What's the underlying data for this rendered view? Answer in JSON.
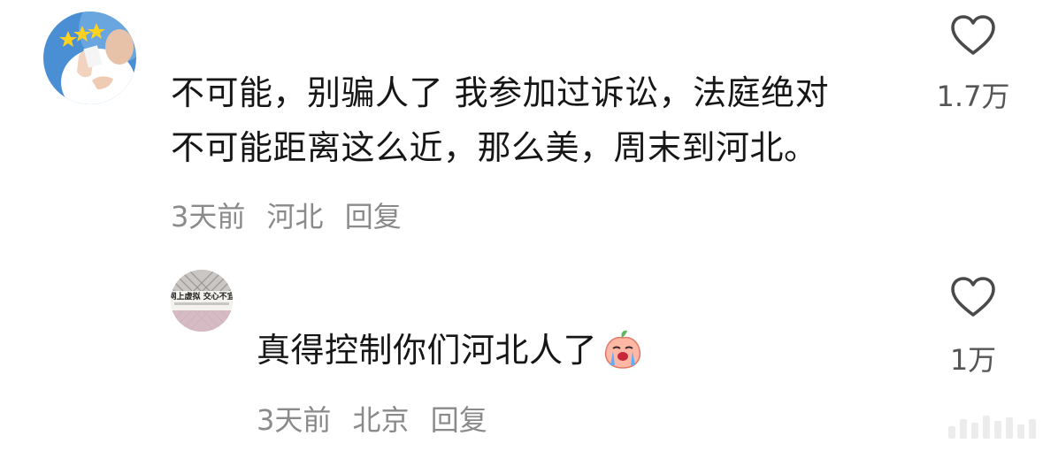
{
  "comments": [
    {
      "avatar": "avatar-photo-man-with-stars",
      "lines": [
        "不可能，别骗人了 我参加过诉讼，法庭绝对",
        "不可能距离这么近，那么美，周末到河北。"
      ],
      "time": "3天前",
      "location": "河北",
      "reply": "回复",
      "likes": "1.7万"
    },
    {
      "avatar": "avatar-sign-fence",
      "avatar_text": "网上虚拟 交心不宜",
      "text": "真得控制你们河北人了",
      "emoji": "crying-peach-emoji",
      "time": "3天前",
      "location": "北京",
      "reply": "回复",
      "likes": "1万"
    }
  ],
  "colors": {
    "text": "#161616",
    "meta": "#8a8a8a",
    "icon": "#555555"
  }
}
